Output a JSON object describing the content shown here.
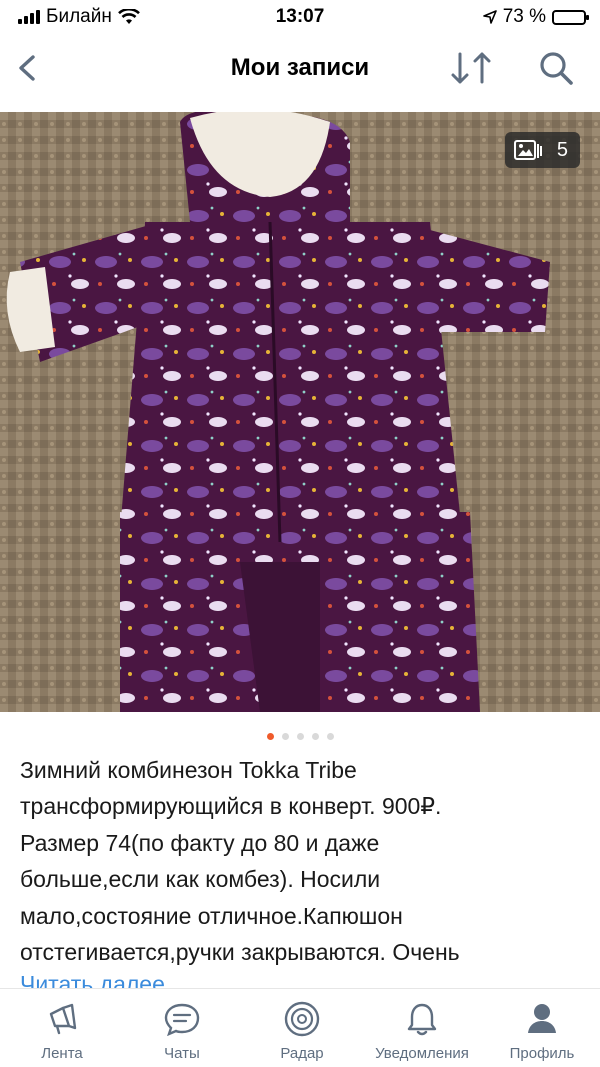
{
  "status_bar": {
    "carrier": "Билайн",
    "time": "13:07",
    "battery": "73 %",
    "battery_level": 0.73
  },
  "nav": {
    "title": "Мои записи",
    "back_icon": "chevron-left-icon",
    "sort_icon": "sort-arrows-icon",
    "search_icon": "search-icon"
  },
  "photo": {
    "count": "5",
    "count_icon": "photo-gallery-icon",
    "pages": 5,
    "active_page": 1,
    "description": "image"
  },
  "post": {
    "lines": [
      "Зимний комбинезон Tokka Tribe",
      "трансформирующийся в конверт. 900₽.",
      "Размер 74(по факту до 80 и даже",
      "больше,если как комбез). Носили",
      "мало,состояние отличное.Капюшон",
      "отстегивается,ручки закрываются. Очень"
    ],
    "read_more": "Читать далее"
  },
  "tabs": [
    {
      "label": "Лента",
      "icon": "megaphone-icon"
    },
    {
      "label": "Чаты",
      "icon": "chat-bubble-icon"
    },
    {
      "label": "Радар",
      "icon": "radar-icon"
    },
    {
      "label": "Уведомления",
      "icon": "bell-icon"
    },
    {
      "label": "Профиль",
      "icon": "person-icon"
    }
  ],
  "colors": {
    "accent": "#ef5b2b",
    "link": "#3b8bdc",
    "tab_icon": "#5f6e80",
    "overall_fabric": "#4a1642"
  }
}
